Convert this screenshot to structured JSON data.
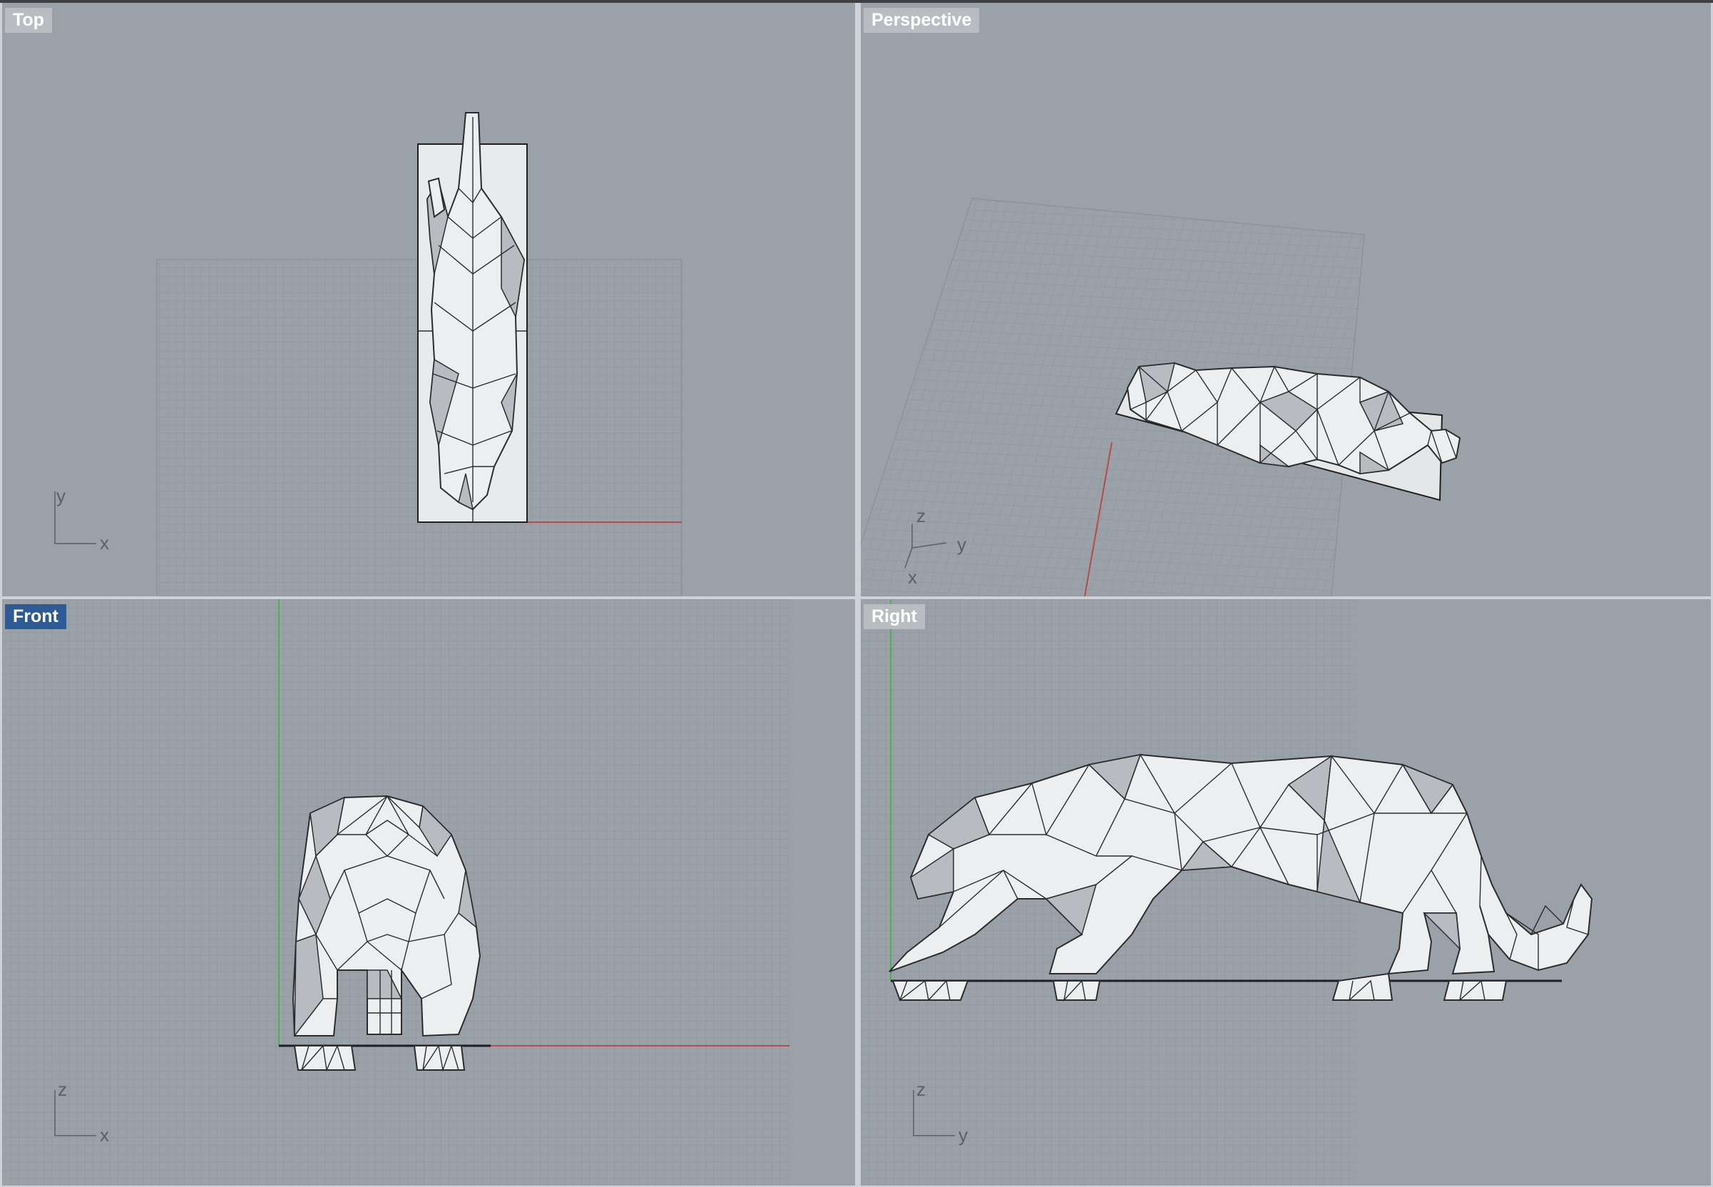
{
  "viewports": {
    "top": {
      "label": "Top",
      "active": false,
      "axes": [
        "y",
        "x"
      ]
    },
    "perspective": {
      "label": "Perspective",
      "active": false,
      "axes": [
        "z",
        "y",
        "x"
      ]
    },
    "front": {
      "label": "Front",
      "active": true,
      "axes": [
        "z",
        "x"
      ]
    },
    "right": {
      "label": "Right",
      "active": false,
      "axes": [
        "z",
        "y"
      ]
    }
  },
  "colors": {
    "viewport_bg": "#9aa1a9",
    "grid_minor": "#8b929a",
    "grid_major": "#7f868e",
    "x_axis": "#b84a4a",
    "y_axis": "#4caf50",
    "active_label": "#2e5b95",
    "model_face": "#eceef0"
  },
  "model": {
    "name_icon": "low-poly-panther-mesh"
  }
}
